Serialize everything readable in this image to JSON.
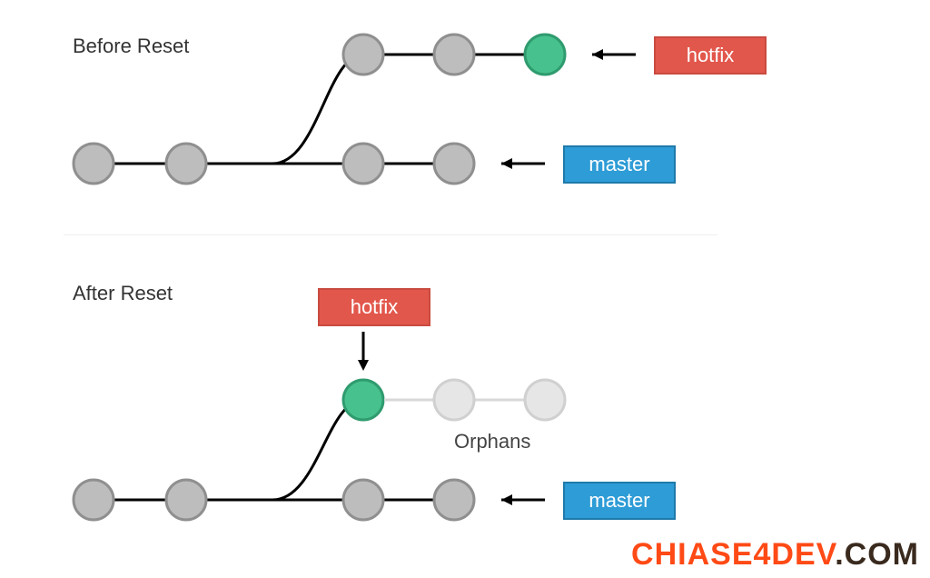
{
  "before": {
    "title": "Before Reset",
    "hotfix_label": "hotfix",
    "master_label": "master",
    "colors": {
      "hotfix": "#e2574c",
      "master": "#2e9cd6",
      "commit_gray": "#bdbdbd",
      "commit_green": "#47c18e"
    },
    "main_commits": 4,
    "hotfix_commits": 3,
    "hotfix_tip_green": true
  },
  "after": {
    "title": "After Reset",
    "hotfix_label": "hotfix",
    "master_label": "master",
    "orphans_label": "Orphans",
    "main_commits": 4,
    "hotfix_commit_green": true,
    "orphan_commits": 2
  },
  "watermark": {
    "part1": "CHIASE4DEV",
    "part2": ".COM"
  }
}
